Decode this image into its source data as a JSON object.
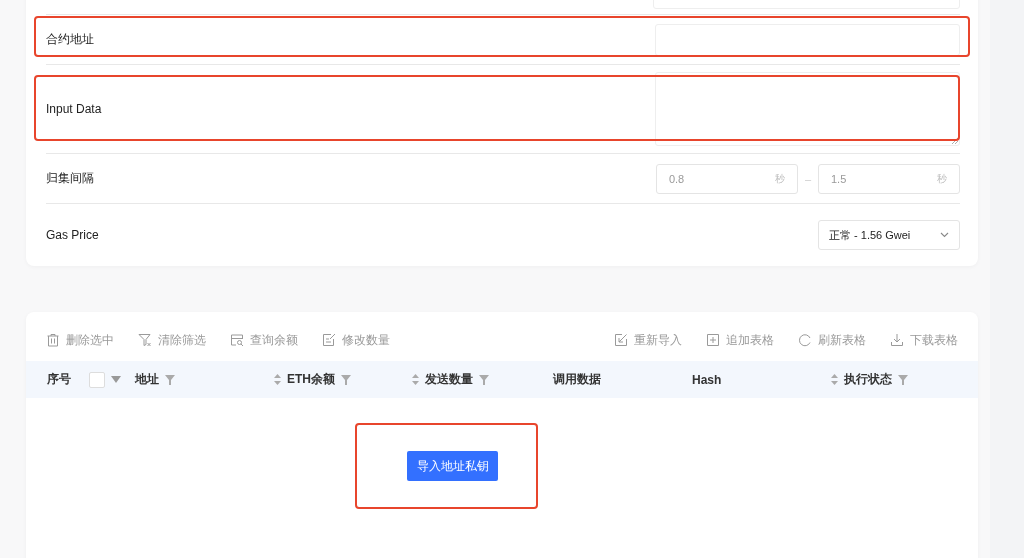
{
  "form": {
    "rows": [
      {
        "kind": "stub"
      },
      {
        "kind": "input",
        "label": "合约地址",
        "highlighted": true
      },
      {
        "kind": "textarea",
        "label": "Input Data",
        "highlighted": true
      },
      {
        "kind": "range",
        "label": "归集间隔",
        "from": {
          "placeholder": "0.8",
          "suffix": "秒"
        },
        "separator": "–",
        "to": {
          "placeholder": "1.5",
          "suffix": "秒"
        },
        "highlighted": false
      },
      {
        "kind": "select",
        "label": "Gas Price",
        "value": "正常 - 1.56 Gwei",
        "highlighted": false
      }
    ]
  },
  "toolbar": {
    "left": [
      {
        "kind": "trash",
        "label": "删除选中"
      },
      {
        "kind": "filter-clear",
        "label": "清除筛选"
      },
      {
        "kind": "query",
        "label": "查询余额"
      },
      {
        "kind": "edit",
        "label": "修改数量"
      }
    ],
    "right": [
      {
        "kind": "import",
        "label": "重新导入"
      },
      {
        "kind": "add",
        "label": "追加表格"
      },
      {
        "kind": "refresh",
        "label": "刷新表格"
      },
      {
        "kind": "download",
        "label": "下载表格"
      }
    ]
  },
  "table": {
    "columns": [
      {
        "kind": "text",
        "label": "序号",
        "sortable": false,
        "filterable": false
      },
      {
        "kind": "select",
        "checked": false
      },
      {
        "kind": "text",
        "label": "地址",
        "sortable": false,
        "filterable": true
      },
      {
        "kind": "text",
        "label": "ETH余额",
        "sortable": true,
        "filterable": true
      },
      {
        "kind": "text",
        "label": "发送数量",
        "sortable": true,
        "filterable": true
      },
      {
        "kind": "text",
        "label": "调用数据",
        "sortable": false,
        "filterable": false
      },
      {
        "kind": "text",
        "label": "Hash",
        "sortable": false,
        "filterable": false
      },
      {
        "kind": "text",
        "label": "执行状态",
        "sortable": true,
        "filterable": true
      }
    ]
  },
  "import_button": {
    "label": "导入地址私钥",
    "highlighted": true
  }
}
